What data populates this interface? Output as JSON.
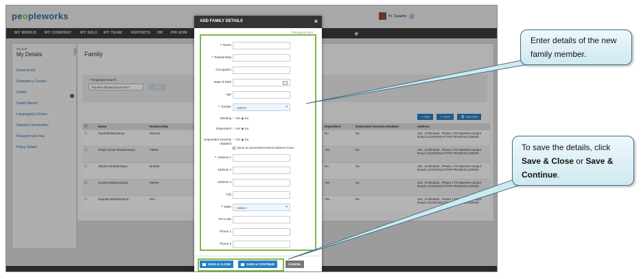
{
  "app": {
    "logo_a": "pe",
    "logo_o": "o",
    "logo_b": "pleworks",
    "user": "Hi, Tapadhir"
  },
  "nav": [
    "MY WORLD",
    "MY COMPANY",
    "MY SELF",
    "MY TEAM",
    "REPORTS",
    "HR",
    "PW ADM"
  ],
  "sidebar": {
    "small": "My Self",
    "title": "My Details",
    "items": [
      "General Info",
      "Emergency Contact",
      "Family",
      "Health Report",
      "Language(s) Known",
      "Statutory Nomination",
      "Passport and Visa",
      "Policy Details"
    ]
  },
  "main": {
    "title": "Family",
    "emp_label": "Employee Search",
    "emp_value": "Tapadhir Bhattacharya-6677",
    "emp_btn": "GO",
    "actions": [
      "+ ADD",
      "✎ EDIT",
      "🗑 DELETE"
    ],
    "columns": [
      "",
      "Name",
      "Relationship",
      "Dependent",
      "Dependent Severely Disabled",
      "Address"
    ],
    "rows": [
      {
        "name": "Piyali Bhattacharya",
        "rel": "Spouse",
        "dep": "No",
        "dis": "No",
        "addr": "104 , Krishnalok , Phase 1 PO Barehra Kanpur Road LUCKNOW,UTTAR PRADESH,226401"
      },
      {
        "name": "Ranjit Kumar Bhattacharya",
        "rel": "Father",
        "dep": "Yes",
        "dis": "No",
        "addr": "104 , Krishnalok , Phase 1 PO Barehra Kanpur Road LUCKNOW,UTTAR PRADESH,226401"
      },
      {
        "name": "Shivam Bhattacharya",
        "rel": "Brother",
        "dep": "No",
        "dis": "No",
        "addr": "104 , Krishnalok , Phase 1 PO Barehra Kanpur Road LUCKNOW,UTTAR PRADESH,226401"
      },
      {
        "name": "Sumitra Bhattacharya",
        "rel": "Mother",
        "dep": "Yes",
        "dis": "No",
        "addr": "104 , Krishnalok , Phase 1 PO Barehra Kanpur Road LUCKNOW,UTTAR PRADESH,226401"
      },
      {
        "name": "Supratik Bhattacharya",
        "rel": "Son",
        "dep": "Yes",
        "dis": "No",
        "addr": "104 , Krishnalok , Phase 1 PO Barehra Kanpur Road LUCKNOW,UTTAR PRADESH,226401"
      }
    ]
  },
  "modal": {
    "title": "ADD FAMILY DETAILS",
    "close": "×",
    "required": "Required Field",
    "fields": {
      "name": "Name",
      "relationship": "Relationship",
      "occupation": "Occupation",
      "dob": "Date of Birth",
      "age": "Age",
      "gender": "Gender",
      "gender_value": "--Select--",
      "working": "Working",
      "dependent": "Dependent",
      "dep_disabled": "Dependent severely disabled",
      "same_addr": "Same as present/permanent address Active",
      "addr1": "Address 1",
      "addr2": "Address 2",
      "addr3": "Address 3",
      "city": "City",
      "state": "State",
      "state_value": "--Select--",
      "pin": "Pin Code",
      "phone1": "Phone 1",
      "phone2": "Phone 2",
      "yes": "Yes",
      "no": "No"
    },
    "save_close": "SAVE & CLOSE",
    "save_continue": "SAVE & CONTINUE",
    "cancel": "CANCEL"
  },
  "callout1": {
    "text": "Enter details of the new family member."
  },
  "callout2": {
    "pre": "To save the details, click",
    "b1": "Save & Close",
    "mid": "or",
    "b2": "Save & Continue",
    "post": "."
  },
  "colors": {
    "accent": "#2680c2",
    "highlight": "#7ab648"
  }
}
